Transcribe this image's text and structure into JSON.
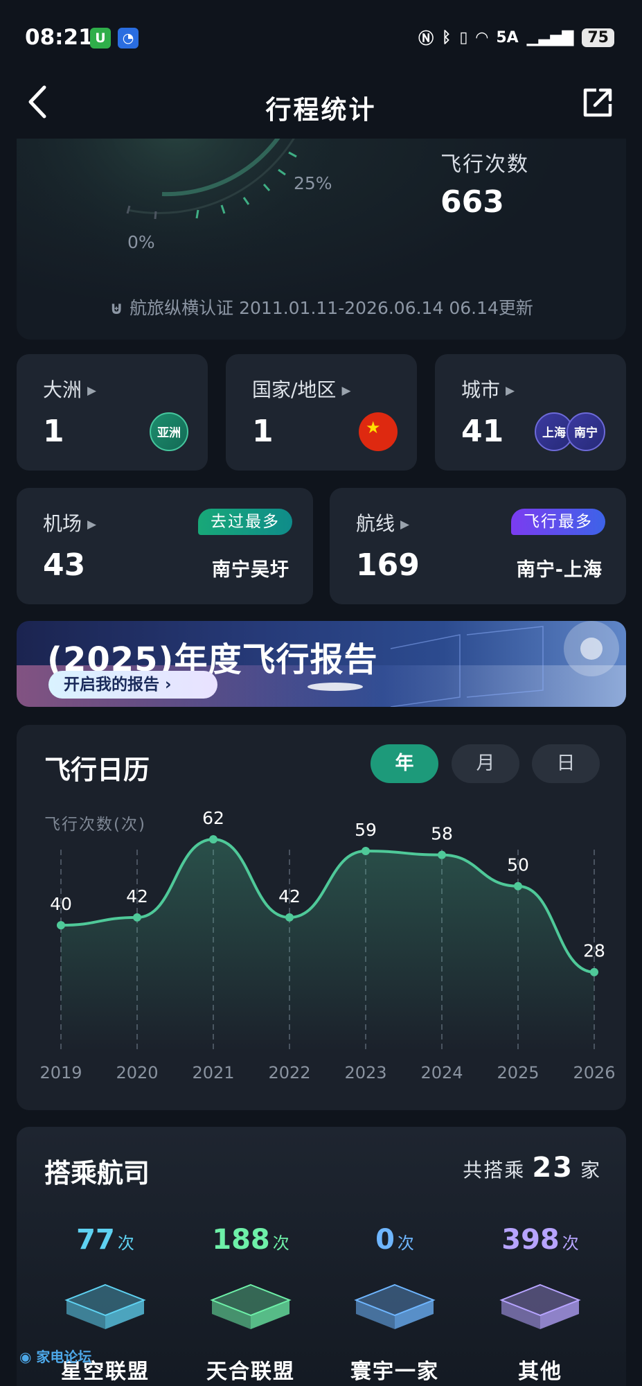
{
  "status_bar": {
    "time": "08:21",
    "network": "5A",
    "battery": "75"
  },
  "header": {
    "title": "行程统计"
  },
  "summary": {
    "gauge_label_25": "25%",
    "gauge_label_0": "0%",
    "flights_label": "飞行次数",
    "flights_value": "663",
    "certification": "航旅纵横认证 2011.01.11-2026.06.14 06.14更新"
  },
  "cards": {
    "continent": {
      "label": "大洲",
      "value": "1",
      "badge": "亚洲"
    },
    "country": {
      "label": "国家/地区",
      "value": "1"
    },
    "city": {
      "label": "城市",
      "value": "41",
      "badge1": "上海",
      "badge2": "南宁"
    },
    "airport": {
      "label": "机场",
      "value": "43",
      "tag": "去过最多",
      "name": "南宁吴圩"
    },
    "route": {
      "label": "航线",
      "value": "169",
      "tag": "飞行最多",
      "name": "南宁-上海"
    }
  },
  "banner": {
    "title": "(2025)年度飞行报告",
    "button": "开启我的报告"
  },
  "calendar": {
    "title": "飞行日历",
    "segments": [
      "年",
      "月",
      "日"
    ],
    "active_segment": 0,
    "y_label": "飞行次数(次)"
  },
  "chart_data": {
    "type": "line",
    "categories": [
      "2019",
      "2020",
      "2021",
      "2022",
      "2023",
      "2024",
      "2025",
      "2026"
    ],
    "series": [
      {
        "values": [
          40,
          42,
          62,
          42,
          59,
          58,
          50,
          28
        ]
      }
    ],
    "ylabel": "飞行次数(次)",
    "grid": "vertical dashed",
    "color": "#4fc999"
  },
  "airlines": {
    "title": "搭乘航司",
    "total_prefix": "共搭乘",
    "total_value": "23",
    "total_suffix": "家",
    "unit": "次",
    "alliances": [
      {
        "name": "星空联盟",
        "count": "77",
        "color": "#5fd2f2"
      },
      {
        "name": "天合联盟",
        "count": "188",
        "color": "#6ef0a8"
      },
      {
        "name": "寰宇一家",
        "count": "0",
        "color": "#6fb6ff"
      },
      {
        "name": "其他",
        "count": "398",
        "color": "#b7a4ff"
      }
    ]
  },
  "colors": {
    "accent": "#1d9a7a",
    "background": "#0f141c",
    "card": "#1e2530"
  }
}
